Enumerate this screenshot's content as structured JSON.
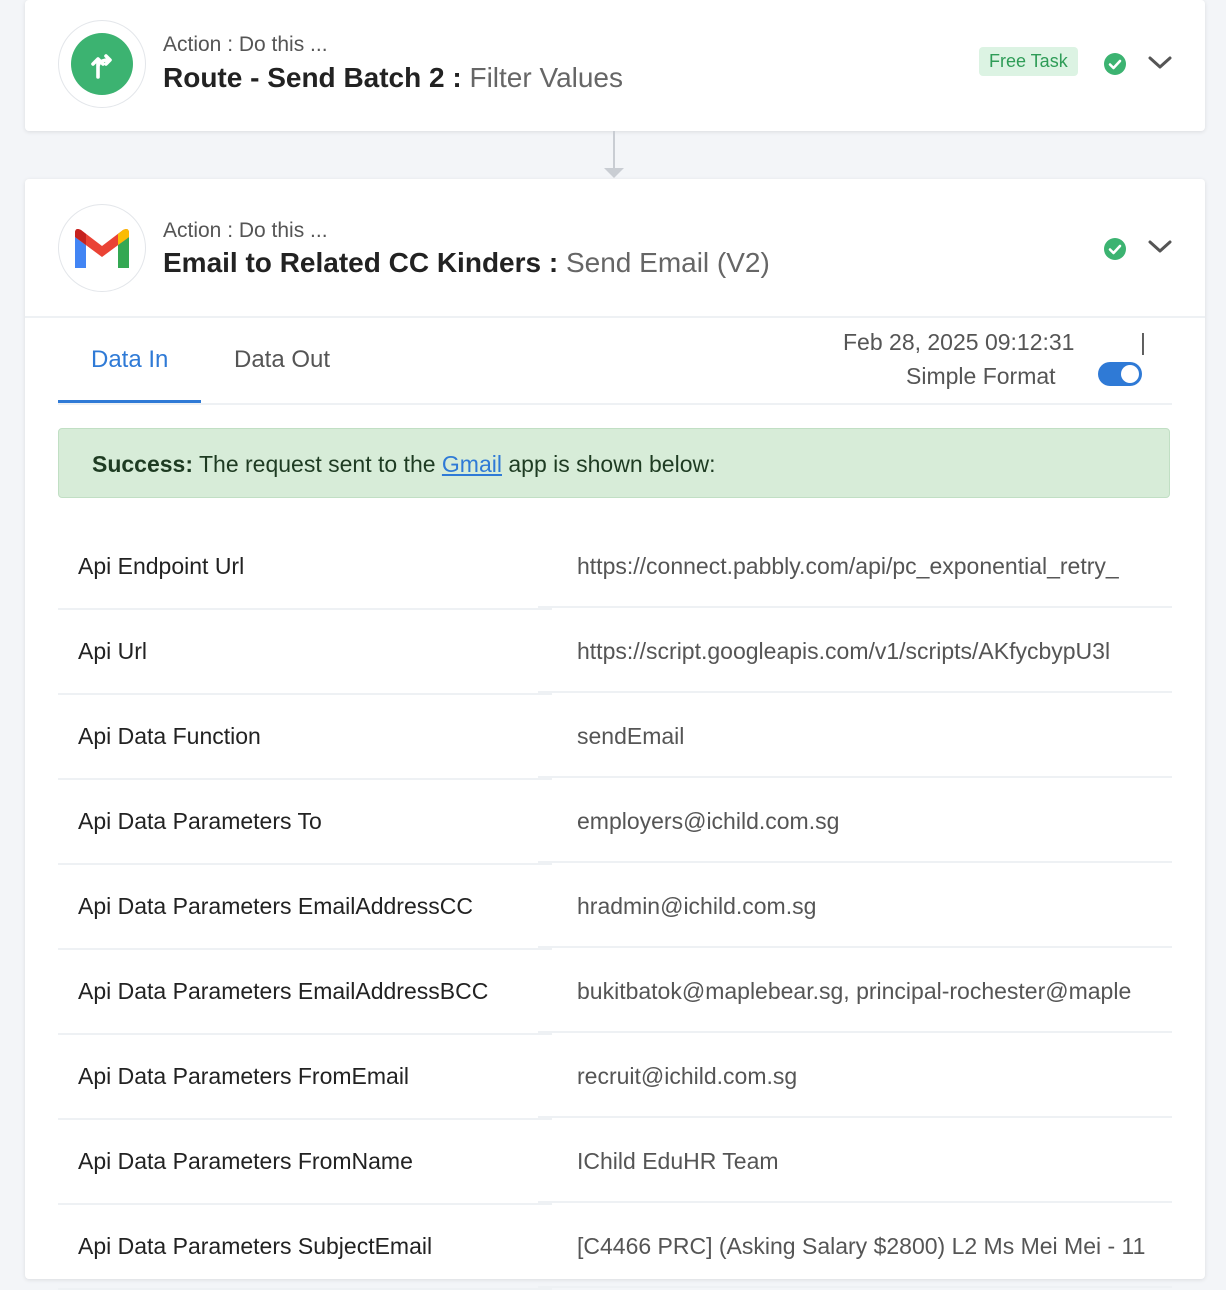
{
  "step1": {
    "kicker": "Action : Do this ...",
    "title": "Route - Send Batch 2 : ",
    "subtitle": "Filter Values",
    "badge": "Free Task",
    "icon": "route-icon",
    "status": "success"
  },
  "step2": {
    "kicker": "Action : Do this ...",
    "title": "Email to Related CC Kinders : ",
    "subtitle": "Send Email (V2)",
    "icon": "gmail-icon",
    "status": "success",
    "tabs": [
      {
        "label": "Data In",
        "active": true
      },
      {
        "label": "Data Out",
        "active": false
      }
    ],
    "timestamp": "Feb 28, 2025 09:12:31",
    "separator": "|",
    "format_label": "Simple Format",
    "format_toggle_on": true,
    "alert": {
      "strong": "Success:",
      "before_link": " The request sent to the ",
      "link": "Gmail",
      "after_link": " app is shown below:"
    },
    "rows": [
      {
        "label": "Api Endpoint Url",
        "value": "https://connect.pabbly.com/api/pc_exponential_retry_"
      },
      {
        "label": "Api Url",
        "value": "https://script.googleapis.com/v1/scripts/AKfycbypU3l"
      },
      {
        "label": "Api Data Function",
        "value": "sendEmail"
      },
      {
        "label": "Api Data Parameters To",
        "value": "employers@ichild.com.sg"
      },
      {
        "label": "Api Data Parameters EmailAddressCC",
        "value": "hradmin@ichild.com.sg"
      },
      {
        "label": "Api Data Parameters EmailAddressBCC",
        "value": "bukitbatok@maplebear.sg, principal-rochester@maple"
      },
      {
        "label": "Api Data Parameters FromEmail",
        "value": "recruit@ichild.com.sg"
      },
      {
        "label": "Api Data Parameters FromName",
        "value": "IChild EduHR Team"
      },
      {
        "label": "Api Data Parameters SubjectEmail",
        "value": "[C4466 PRC] (Asking Salary $2800) L2 Ms Mei Mei - 11"
      }
    ]
  },
  "colors": {
    "accent": "#2f7ad6",
    "success": "#3cb371",
    "alert_bg": "#d7ecd8"
  }
}
